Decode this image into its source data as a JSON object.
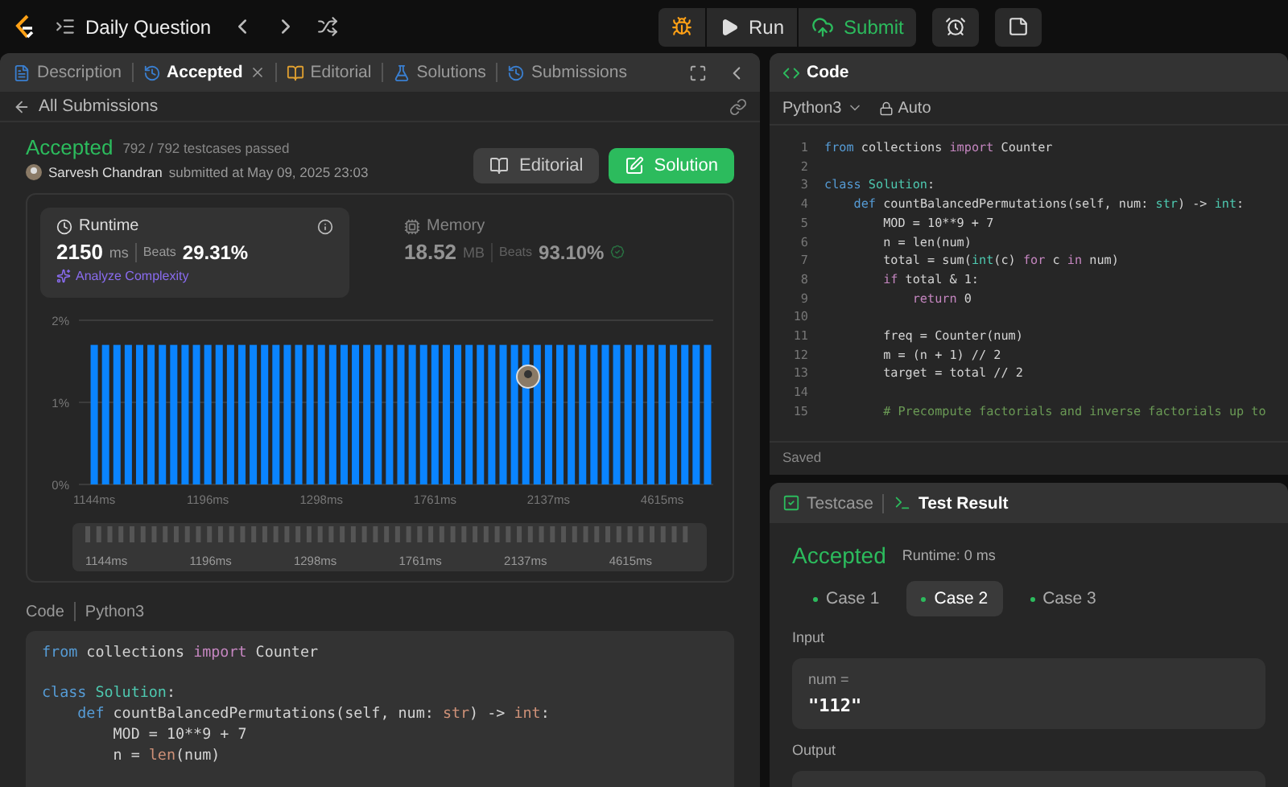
{
  "topbar": {
    "title": "Daily Question",
    "run": "Run",
    "submit": "Submit"
  },
  "left_tabs": [
    {
      "label": "Description",
      "selected": false,
      "closable": false
    },
    {
      "label": "Accepted",
      "selected": true,
      "closable": true
    },
    {
      "label": "Editorial",
      "selected": false,
      "closable": false
    },
    {
      "label": "Solutions",
      "selected": false,
      "closable": false
    },
    {
      "label": "Submissions",
      "selected": false,
      "closable": false
    }
  ],
  "back_link": "All Submissions",
  "submission": {
    "status": "Accepted",
    "testcases": "792 / 792 testcases passed",
    "author": "Sarvesh Chandran",
    "submitted": "submitted at May 09, 2025 23:03",
    "buttons": [
      {
        "label": "Editorial",
        "kind": "secondary"
      },
      {
        "label": "Solution",
        "kind": "primary"
      }
    ]
  },
  "metrics": [
    {
      "kind": "runtime",
      "label": "Runtime",
      "value": "2150",
      "unit": "ms",
      "beats_label": "Beats",
      "beats": "29.31%",
      "selected": true,
      "link": "Analyze Complexity"
    },
    {
      "kind": "memory",
      "label": "Memory",
      "value": "18.52",
      "unit": "MB",
      "beats_label": "Beats",
      "beats": "93.10%",
      "selected": false
    }
  ],
  "chart_data": {
    "type": "bar",
    "ylim": [
      0,
      2
    ],
    "yticks": [
      {
        "value": 0,
        "label": "0%"
      },
      {
        "value": 1,
        "label": "1%"
      },
      {
        "value": 2,
        "label": "2%"
      }
    ],
    "categories": [
      "1144ms",
      null,
      null,
      null,
      null,
      null,
      null,
      null,
      null,
      null,
      "1196ms",
      null,
      null,
      null,
      null,
      null,
      null,
      null,
      null,
      null,
      "1298ms",
      null,
      null,
      null,
      null,
      null,
      null,
      null,
      null,
      null,
      "1761ms",
      null,
      null,
      null,
      null,
      null,
      null,
      null,
      null,
      null,
      "2137ms",
      null,
      null,
      null,
      null,
      null,
      null,
      null,
      null,
      null,
      "4615ms",
      null,
      null,
      null,
      null
    ],
    "values": [
      1.7,
      1.7,
      1.7,
      1.7,
      1.7,
      1.7,
      1.7,
      1.7,
      1.7,
      1.7,
      1.7,
      1.7,
      1.7,
      1.7,
      1.7,
      1.7,
      1.7,
      1.7,
      1.7,
      1.7,
      1.7,
      1.7,
      1.7,
      1.7,
      1.7,
      1.7,
      1.7,
      1.7,
      1.7,
      1.7,
      1.7,
      1.7,
      1.7,
      1.7,
      1.7,
      1.7,
      1.7,
      1.7,
      1.7,
      1.7,
      1.7,
      1.7,
      1.7,
      1.7,
      1.7,
      1.7,
      1.7,
      1.7,
      1.7,
      1.7,
      1.7,
      1.7,
      1.7,
      1.7,
      1.7
    ]
  },
  "navigator_labels": [
    "1144ms",
    "1196ms",
    "1298ms",
    "1761ms",
    "2137ms",
    "4615ms"
  ],
  "code_section": {
    "label": "Code",
    "language": "Python3",
    "lines": [
      {
        "s": [
          {
            "kind": "kw",
            "text": "from"
          },
          {
            "kind": "p",
            "text": " collections "
          },
          {
            "kind": "ctl",
            "text": "import"
          },
          {
            "kind": "p",
            "text": " Counter"
          }
        ]
      },
      {
        "space_before": true,
        "s": [
          {
            "kind": "kw",
            "text": "class"
          },
          {
            "kind": "cls",
            "text": " Solution"
          },
          {
            "kind": "p",
            "text": ":"
          }
        ]
      },
      {
        "s": [
          {
            "kind": "kw",
            "text": "    def"
          },
          {
            "kind": "p",
            "text": " countBalancedPermutations(self, num: "
          },
          {
            "kind": "type",
            "text": "str"
          },
          {
            "kind": "p",
            "text": ") -> "
          },
          {
            "kind": "type",
            "text": "int"
          },
          {
            "kind": "p",
            "text": ":"
          }
        ]
      },
      {
        "s": [
          {
            "kind": "p",
            "text": "        MOD = 10**9 + 7"
          }
        ]
      },
      {
        "s": [
          {
            "kind": "p",
            "text": "        n = "
          },
          {
            "kind": "type",
            "text": "len"
          },
          {
            "kind": "p",
            "text": "(num)"
          }
        ]
      }
    ]
  },
  "editor": {
    "title": "Code",
    "language": "Python3",
    "mode": "Auto",
    "status": "Saved",
    "lines": [
      {
        "n": "1",
        "s": [
          {
            "kind": "kw",
            "text": "from"
          },
          {
            "kind": "p",
            "text": " collections "
          },
          {
            "kind": "ctl",
            "text": "import"
          },
          {
            "kind": "p",
            "text": " Counter"
          }
        ]
      },
      {
        "n": "2"
      },
      {
        "n": "3",
        "s": [
          {
            "kind": "kw",
            "text": "class"
          },
          {
            "kind": "cls",
            "text": " Solution"
          },
          {
            "kind": "p",
            "text": ":"
          }
        ]
      },
      {
        "n": "4",
        "s": [
          {
            "kind": "kw",
            "text": "    def"
          },
          {
            "kind": "p",
            "text": " countBalancedPermutations(self, num: "
          },
          {
            "kind": "cls",
            "text": "str"
          },
          {
            "kind": "p",
            "text": ") -> "
          },
          {
            "kind": "cls",
            "text": "int"
          },
          {
            "kind": "p",
            "text": ":"
          }
        ]
      },
      {
        "n": "5",
        "s": [
          {
            "kind": "p",
            "text": "        MOD = 10**9 + 7"
          }
        ]
      },
      {
        "n": "6",
        "s": [
          {
            "kind": "p",
            "text": "        n = len(num)"
          }
        ]
      },
      {
        "n": "7",
        "s": [
          {
            "kind": "p",
            "text": "        total = sum("
          },
          {
            "kind": "cls",
            "text": "int"
          },
          {
            "kind": "p",
            "text": "(c) "
          },
          {
            "kind": "ctl",
            "text": "for"
          },
          {
            "kind": "p",
            "text": " c "
          },
          {
            "kind": "ctl",
            "text": "in"
          },
          {
            "kind": "p",
            "text": " num)"
          }
        ]
      },
      {
        "n": "8",
        "s": [
          {
            "kind": "ctl",
            "text": "        if"
          },
          {
            "kind": "p",
            "text": " total & 1:"
          }
        ]
      },
      {
        "n": "9",
        "s": [
          {
            "kind": "ctl",
            "text": "            return"
          },
          {
            "kind": "p",
            "text": " 0"
          }
        ]
      },
      {
        "n": "10"
      },
      {
        "n": "11",
        "s": [
          {
            "kind": "p",
            "text": "        freq = Counter(num)"
          }
        ]
      },
      {
        "n": "12",
        "s": [
          {
            "kind": "p",
            "text": "        m = (n + 1) // 2"
          }
        ]
      },
      {
        "n": "13",
        "s": [
          {
            "kind": "p",
            "text": "        target = total // 2"
          }
        ]
      },
      {
        "n": "14"
      },
      {
        "n": "15",
        "s": [
          {
            "kind": "comment",
            "text": "        # Precompute factorials and inverse factorials up to"
          }
        ]
      }
    ]
  },
  "bottom": {
    "tabs": [
      {
        "label": "Testcase",
        "selected": false
      },
      {
        "label": "Test Result",
        "selected": true
      }
    ],
    "status": "Accepted",
    "runtime": "Runtime: 0 ms",
    "cases": [
      {
        "label": "Case 1",
        "selected": false
      },
      {
        "label": "Case 2",
        "selected": true
      },
      {
        "label": "Case 3",
        "selected": false
      }
    ],
    "input_label": "Input",
    "input_name": "num =",
    "input_value": "\"112\"",
    "output_label": "Output"
  }
}
